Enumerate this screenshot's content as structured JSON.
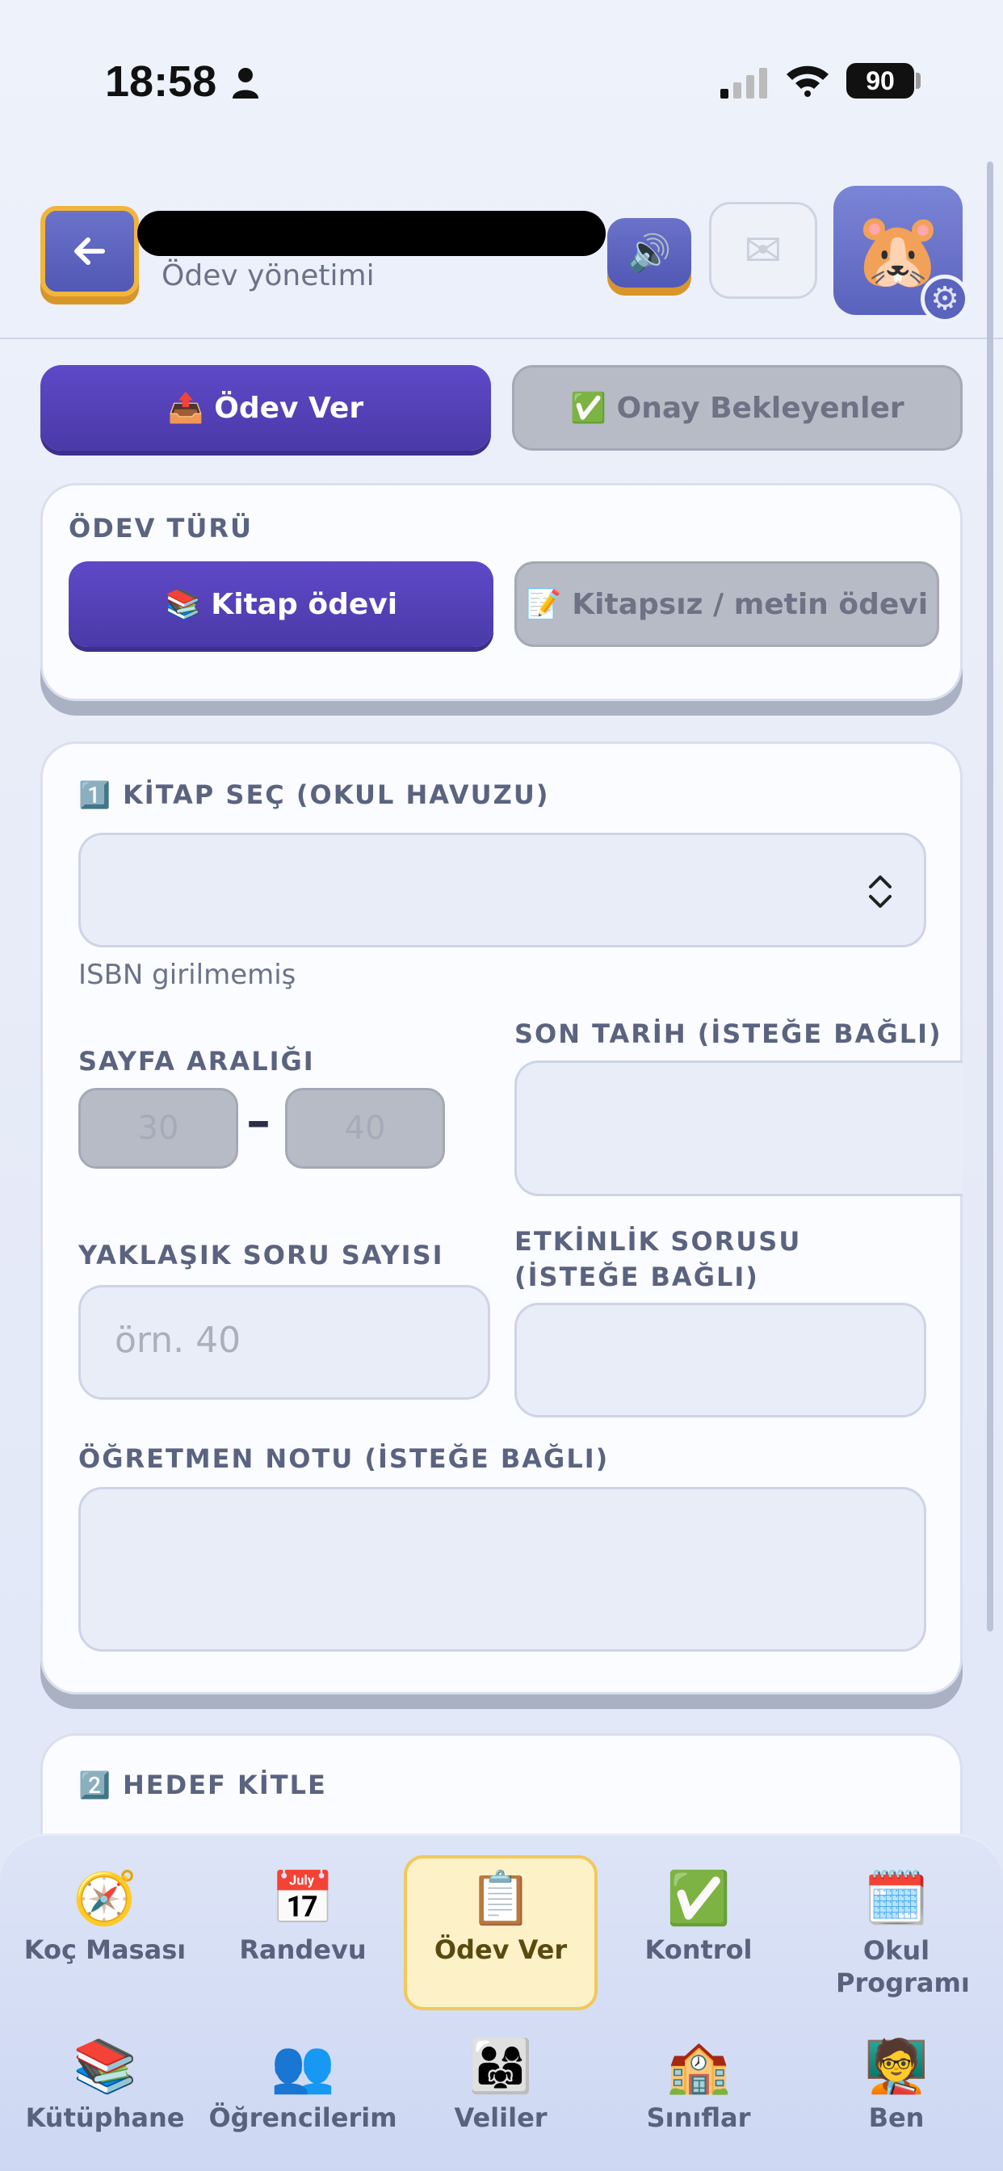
{
  "status": {
    "time": "18:58",
    "battery": "90"
  },
  "header": {
    "subtitle": "Ödev yönetimi",
    "back_icon": "arrow-left-icon",
    "sound_icon": "speaker-icon",
    "mail_icon": "envelope-icon",
    "avatar_icon": "hamster-avatar",
    "settings_icon": "gear-icon"
  },
  "top_tabs": {
    "assign": "📤 Ödev Ver",
    "pending": "✅ Onay Bekleyenler"
  },
  "homework_type": {
    "label": "ÖDEV TÜRÜ",
    "book": "📚 Kitap ödevi",
    "text": "📝 Kitapsız / metin ödevi"
  },
  "form": {
    "select_book_label": "1️⃣ KİTAP SEÇ (OKUL HAVUZU)",
    "isbn_hint": "ISBN girilmemiş",
    "page_range_label": "SAYFA ARALIĞI",
    "page_from": "30",
    "page_to": "40",
    "page_dash": "–",
    "due_date_label": "SON TARİH (İSTEĞE BAĞLI)",
    "question_count_label": "YAKLAŞIK SORU SAYISI",
    "question_count_placeholder": "örn. 40",
    "activity_label": "ETKİNLİK SORUSU (İSTEĞE BAĞLI)",
    "teacher_note_label": "ÖĞRETMEN NOTU (İSTEĞE BAĞLI)"
  },
  "target": {
    "label": "2️⃣ HEDEF KİTLE"
  },
  "nav": [
    {
      "label": "Koç Masası",
      "icon": "🧭"
    },
    {
      "label": "Randevu",
      "icon": "📅"
    },
    {
      "label": "Ödev Ver",
      "icon": "📋"
    },
    {
      "label": "Kontrol",
      "icon": "✅"
    },
    {
      "label": "Okul Programı",
      "icon": "🗓️"
    },
    {
      "label": "Kütüphane",
      "icon": "📚"
    },
    {
      "label": "Öğrencilerim",
      "icon": "👥"
    },
    {
      "label": "Veliler",
      "icon": "👨‍👩‍👧"
    },
    {
      "label": "Sınıflar",
      "icon": "🏫"
    },
    {
      "label": "Ben",
      "icon": "🧑‍🏫"
    }
  ]
}
